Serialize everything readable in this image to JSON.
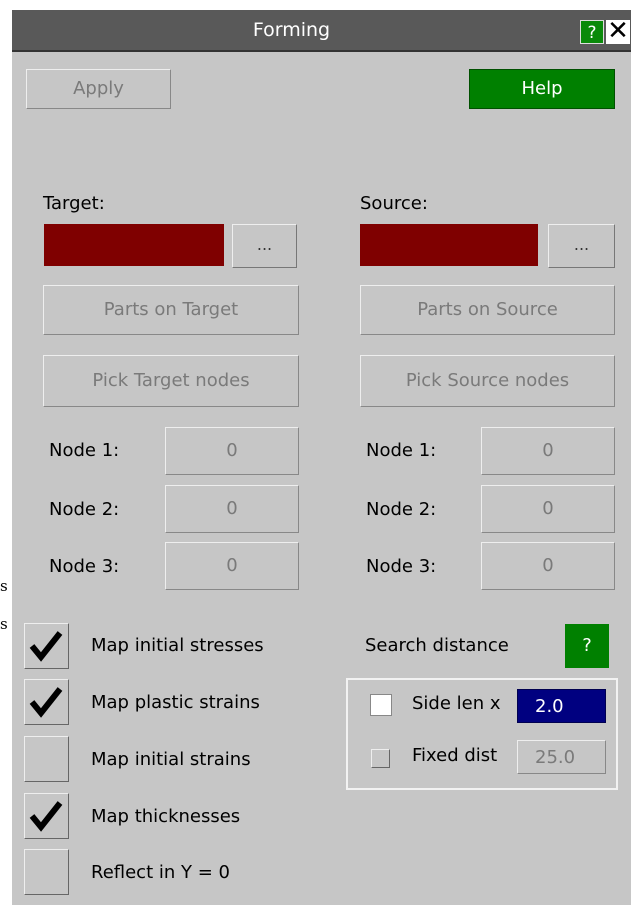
{
  "stray_text": [
    "s",
    "s"
  ],
  "window": {
    "title": "Forming",
    "help_glyph": "?",
    "close_glyph": "✕"
  },
  "toolbar": {
    "apply_label": "Apply",
    "help_label": "Help"
  },
  "target": {
    "heading": "Target:",
    "dots_label": "...",
    "parts_label": "Parts on Target",
    "pick_label": "Pick Target nodes",
    "nodes": [
      {
        "label": "Node 1:",
        "value": "0"
      },
      {
        "label": "Node 2:",
        "value": "0"
      },
      {
        "label": "Node 3:",
        "value": "0"
      }
    ]
  },
  "source": {
    "heading": "Source:",
    "dots_label": "...",
    "parts_label": "Parts on Source",
    "pick_label": "Pick Source nodes",
    "nodes": [
      {
        "label": "Node 1:",
        "value": "0"
      },
      {
        "label": "Node 2:",
        "value": "0"
      },
      {
        "label": "Node 3:",
        "value": "0"
      }
    ]
  },
  "options": [
    {
      "label": "Map initial stresses",
      "checked": true
    },
    {
      "label": "Map plastic strains",
      "checked": true
    },
    {
      "label": "Map initial strains",
      "checked": false
    },
    {
      "label": "Map thicknesses",
      "checked": true
    },
    {
      "label": "Reflect in Y = 0",
      "checked": false
    }
  ],
  "search": {
    "label": "Search distance",
    "help_glyph": "?",
    "side_len": {
      "label": "Side len x",
      "value": "2.0",
      "checked": false
    },
    "fixed_dist": {
      "label": "Fixed dist",
      "value": "25.0",
      "checked": false
    }
  },
  "colors": {
    "panel": "#c6c6c6",
    "titlebar": "#595959",
    "help_green": "#008000",
    "swatch": "#7f0000",
    "active_input": "#000080"
  }
}
